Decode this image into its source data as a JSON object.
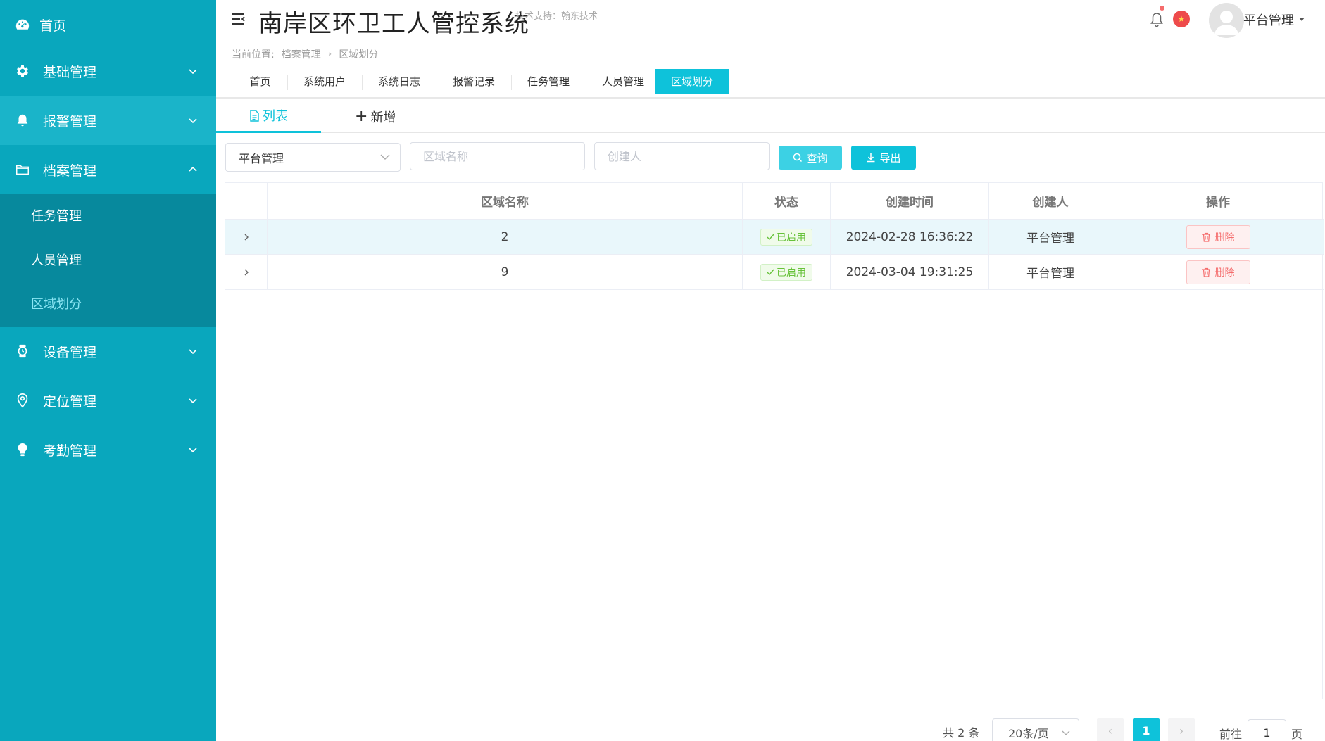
{
  "header": {
    "title": "南岸区环卫工人管控系统",
    "tech_support": "技术支持：翰东技术",
    "user_name": "平台管理"
  },
  "sidebar": {
    "items": [
      {
        "label": "首页",
        "icon": "dashboard-icon"
      },
      {
        "label": "基础管理",
        "icon": "gear-icon"
      },
      {
        "label": "报警管理",
        "icon": "bell-icon"
      },
      {
        "label": "档案管理",
        "icon": "folder-icon"
      },
      {
        "label": "设备管理",
        "icon": "watch-icon"
      },
      {
        "label": "定位管理",
        "icon": "location-pin-icon"
      },
      {
        "label": "考勤管理",
        "icon": "bulb-icon"
      }
    ],
    "submenu": [
      {
        "label": "任务管理"
      },
      {
        "label": "人员管理"
      },
      {
        "label": "区域划分"
      }
    ]
  },
  "breadcrumb": {
    "prefix": "当前位置:",
    "parent": "档案管理",
    "current": "区域划分"
  },
  "tabs": [
    "首页",
    "系统用户",
    "系统日志",
    "报警记录",
    "任务管理",
    "人员管理",
    "区域划分"
  ],
  "subtabs": {
    "list": "列表",
    "new": "新增"
  },
  "filters": {
    "select_value": "平台管理",
    "area_placeholder": "区域名称",
    "creator_placeholder": "创建人",
    "query_label": "查询",
    "export_label": "导出"
  },
  "table": {
    "headers": [
      "区域名称",
      "状态",
      "创建时间",
      "创建人",
      "操作"
    ],
    "rows": [
      {
        "name": "2",
        "status": "已启用",
        "created": "2024-02-28 16:36:22",
        "creator": "平台管理",
        "action": "删除"
      },
      {
        "name": "9",
        "status": "已启用",
        "created": "2024-03-04 19:31:25",
        "creator": "平台管理",
        "action": "删除"
      }
    ]
  },
  "pagination": {
    "total": "共 2 条",
    "page_size": "20条/页",
    "current_page": "1",
    "goto_label": "前往",
    "goto_value": "1",
    "page_suffix": "页"
  },
  "colors": {
    "sidebar_bg": "#09a7bd",
    "accent": "#0ec2da",
    "danger": "#f56c6c",
    "success": "#67c23a"
  }
}
